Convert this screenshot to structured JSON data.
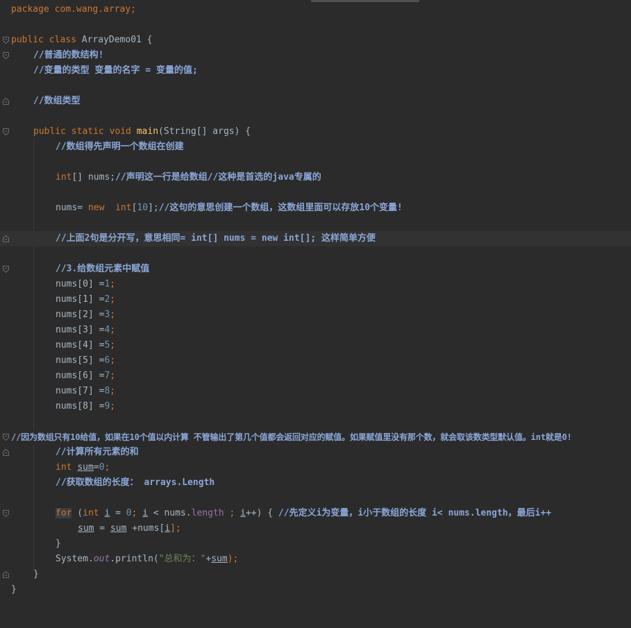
{
  "editor": {
    "lines": {
      "l1": "package com.wang.array;",
      "l3a": "public class ",
      "l3b": "ArrayDemo01 {",
      "l4": "//普通的数结构!",
      "l5": "//变量的类型 变量的名字 = 变量的值;",
      "l7": "//数组类型",
      "l9a": "public static void ",
      "l9b": "main",
      "l9c": "(String[] args) {",
      "l10": "//数组得先声明一个数组在创建",
      "l12a": "int",
      "l12b": "[] nums;",
      "l12c": "//声明这一行是给数组//这种是首选的java专属的",
      "l14a": "nums= ",
      "l14b": "new  ",
      "l14c": "int",
      "l14d": "[",
      "l14e": "10",
      "l14f": "];",
      "l14g": "//这句的意思创建一个数组，这数组里面可以存放10个变量!",
      "l16": "//上面2句是分开写，意思相同= int[] nums = new int[]; 这样简单方便",
      "l18": "//3.给数组元素中赋值",
      "l29": "//因为数组只有10给值，如果在10个值以内计算 不管输出了第几个值都会返回对应的赋值。如果赋值里没有那个数，就会取该数类型默认值。int就是0!",
      "l30": "//计算所有元素的和",
      "l31a": "int ",
      "l31b": "sum",
      "l31c": "=",
      "l31d": "0",
      "l31e": ";",
      "l32": "//获取数组的长度： arrays.Length",
      "l34a": "for",
      "l34b": " (",
      "l34c": "int ",
      "l34d": "i",
      "l34e": " = ",
      "l34f": "0",
      "l34g": "; ",
      "l34h": "i",
      "l34i": " < nums.",
      "l34j": "length",
      "l34k": " ; ",
      "l34l": "i",
      "l34m": "++) { ",
      "l34n": "//先定义i为变量，i小于数组的长度 i< nums.length，最后i++",
      "l35a": "sum",
      "l35b": " = ",
      "l35c": "sum",
      "l35d": " +nums[",
      "l35e": "i",
      "l35f": "];",
      "l36": "}",
      "l37a": "System.",
      "l37b": "out",
      "l37c": ".println(",
      "l37d": "\"总和为：\"",
      "l37e": "+",
      "l37f": "sum",
      "l37g": ");",
      "l38": "}",
      "l39": "}"
    },
    "assignments": [
      {
        "lhs": "nums[0] =",
        "val": "1",
        "semi": ";"
      },
      {
        "lhs": "nums[1] =",
        "val": "2",
        "semi": ";"
      },
      {
        "lhs": "nums[2] =",
        "val": "3",
        "semi": ";"
      },
      {
        "lhs": "nums[3] =",
        "val": "4",
        "semi": ";"
      },
      {
        "lhs": "nums[4] =",
        "val": "5",
        "semi": ";"
      },
      {
        "lhs": "nums[5] =",
        "val": "6",
        "semi": ";"
      },
      {
        "lhs": "nums[6] =",
        "val": "7",
        "semi": ";"
      },
      {
        "lhs": "nums[7] =",
        "val": "8",
        "semi": ";"
      },
      {
        "lhs": "nums[8] =",
        "val": "9",
        "semi": ";"
      }
    ]
  },
  "colors": {
    "background": "#2b2b2b",
    "keyword": "#cc7832",
    "number": "#6897bb",
    "comment": "#8ba7d8",
    "method": "#ffc66d",
    "string": "#6a8759",
    "field": "#9876aa",
    "text": "#a9b7c6"
  }
}
